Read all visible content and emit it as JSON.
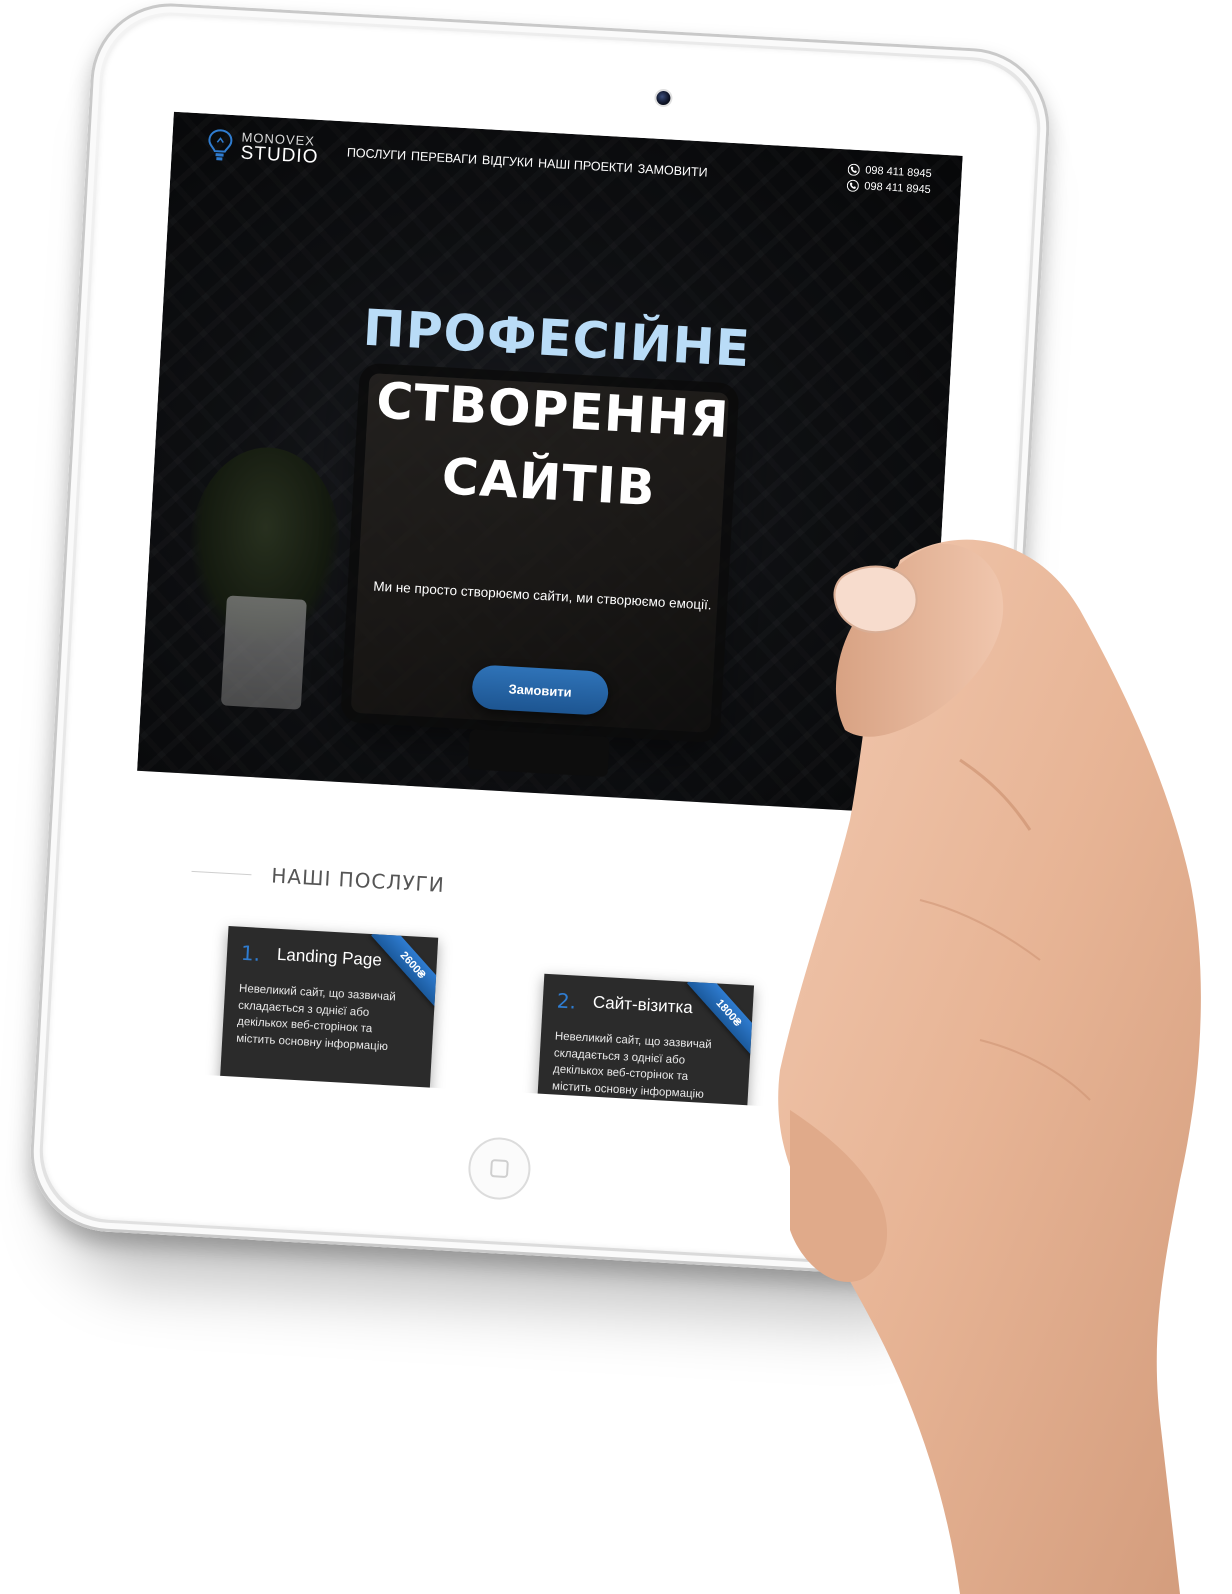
{
  "logo": {
    "line1": "MONOVEX",
    "line2": "STUDIO"
  },
  "nav": {
    "items": [
      {
        "label": "ПОСЛУГИ"
      },
      {
        "label": "ПЕРЕВАГИ"
      },
      {
        "label": "ВІДГУКИ"
      },
      {
        "label": "НАШІ ПРОЕКТИ"
      },
      {
        "label": "ЗАМОВИТИ"
      }
    ]
  },
  "contacts": {
    "phone1": "098 411 8945",
    "phone2": "098 411 8945",
    "icon": "phone-icon"
  },
  "hero": {
    "title_line1": "ПРОФЕСІЙНЕ",
    "title_line2": "СТВОРЕННЯ",
    "title_line3": "САЙТІВ",
    "subtitle": "Ми не просто створюємо сайти, ми створюємо емоції.",
    "cta_label": "Замовити"
  },
  "services": {
    "section_title": "НАШІ ПОСЛУГИ",
    "cards": [
      {
        "number": "1.",
        "title": "Landing Page",
        "price": "2600₴",
        "text": "Невеликий сайт, що зазвичай складається з однієї або декількох веб-сторінок та містить основну інформацію"
      },
      {
        "number": "2.",
        "title": "Сайт-візитка",
        "price": "1800₴",
        "text": "Невеликий сайт, що зазвичай складається з однієї або декількох веб-сторінок та містить основну інформацію"
      }
    ]
  },
  "colors": {
    "accent": "#2f7cd0",
    "hero_title_highlight": "#b9dcf7",
    "card_bg": "#2b2b2b"
  }
}
